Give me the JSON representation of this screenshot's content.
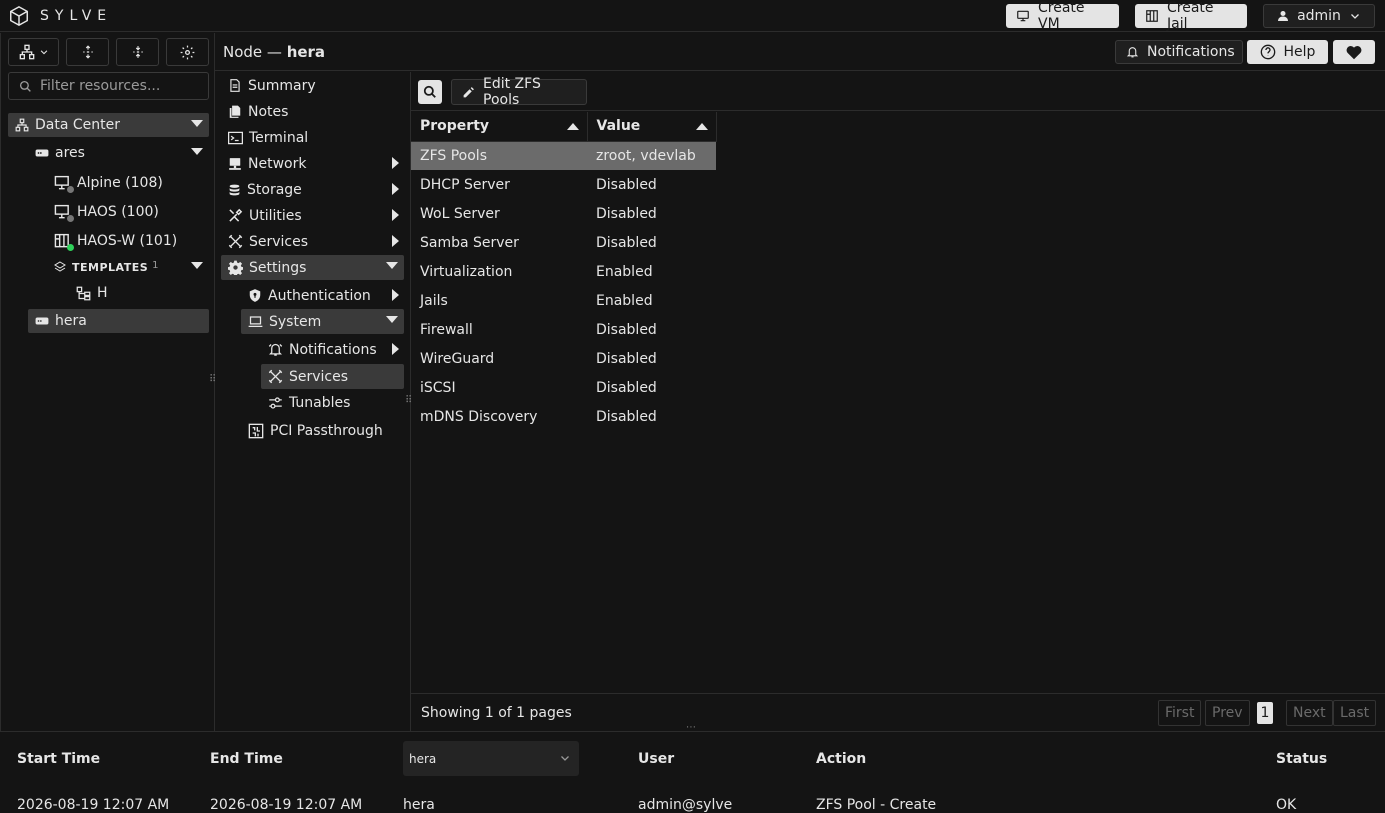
{
  "app": {
    "name": "SYLVE"
  },
  "topbar": {
    "create_vm": "Create VM",
    "create_jail": "Create Jail",
    "user": "admin"
  },
  "left": {
    "filter_placeholder": "Filter resources...",
    "tree": {
      "datacenter": "Data Center",
      "ares": "ares",
      "alpine": "Alpine (108)",
      "haos": "HAOS (100)",
      "haos_w": "HAOS-W (101)",
      "templates": "TEMPLATES",
      "templates_count": "1",
      "template_h": "H",
      "hera": "hera"
    }
  },
  "header": {
    "node_prefix": "Node — ",
    "node_name": "hera",
    "notifications": "Notifications",
    "help": "Help"
  },
  "menu": {
    "summary": "Summary",
    "notes": "Notes",
    "terminal": "Terminal",
    "network": "Network",
    "storage": "Storage",
    "utilities": "Utilities",
    "services": "Services",
    "settings": "Settings",
    "authentication": "Authentication",
    "system": "System",
    "notifications": "Notifications",
    "sys_services": "Services",
    "tunables": "Tunables",
    "pci": "PCI Passthrough"
  },
  "content": {
    "edit_button": "Edit ZFS Pools",
    "columns": [
      "Property",
      "Value"
    ],
    "rows": [
      [
        "ZFS Pools",
        "zroot, vdevlab"
      ],
      [
        "DHCP Server",
        "Disabled"
      ],
      [
        "WoL Server",
        "Disabled"
      ],
      [
        "Samba Server",
        "Disabled"
      ],
      [
        "Virtualization",
        "Enabled"
      ],
      [
        "Jails",
        "Enabled"
      ],
      [
        "Firewall",
        "Disabled"
      ],
      [
        "WireGuard",
        "Disabled"
      ],
      [
        "iSCSI",
        "Disabled"
      ],
      [
        "mDNS Discovery",
        "Disabled"
      ]
    ],
    "pagination": {
      "summary": "Showing 1 of 1 pages",
      "first": "First",
      "prev": "Prev",
      "page": "1",
      "next": "Next",
      "last": "Last"
    }
  },
  "tasks": {
    "headers": {
      "start": "Start Time",
      "end": "End Time",
      "node_filter": "hera",
      "user": "User",
      "action": "Action",
      "status": "Status"
    },
    "row": {
      "start": "2026-08-19 12:07 AM",
      "end": "2026-08-19 12:07 AM",
      "node": "hera",
      "user": "admin@sylve",
      "action": "ZFS Pool - Create",
      "status": "OK"
    }
  },
  "colors": {
    "accent_green": "#2fd15a",
    "selected_bg": "#3a3a3a",
    "row_selected": "#6b6b6b"
  }
}
